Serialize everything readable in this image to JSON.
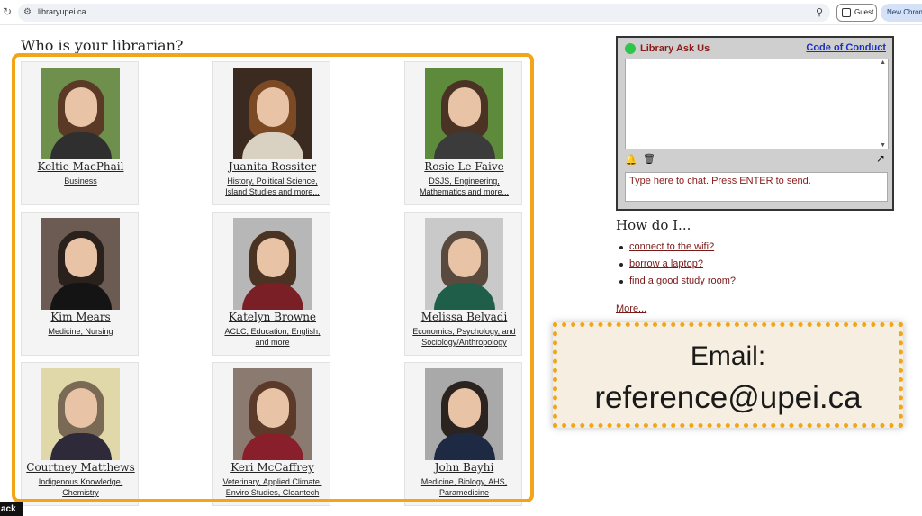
{
  "browser": {
    "url": "libraryupei.ca",
    "guest_label": "Guest",
    "new_chrome_label": "New Chrome"
  },
  "page": {
    "title": "Who is your librarian?"
  },
  "librarians": [
    {
      "name": "Keltie MacPhail",
      "subjects": [
        "Business"
      ],
      "photo_bg": "#6f8f4d",
      "hair": "#5a3a26",
      "top": "#2f2f2f"
    },
    {
      "name": "Juanita Rossiter",
      "subjects": [
        "History, Political Science,",
        "Island Studies and more..."
      ],
      "photo_bg": "#3a2a20",
      "hair": "#7b4a25",
      "top": "#d9d2c2"
    },
    {
      "name": "Rosie Le Faive",
      "subjects": [
        "DSJS, Engineering,",
        "Mathematics and more..."
      ],
      "photo_bg": "#5e8a3b",
      "hair": "#4a3324",
      "top": "#3b3b3b"
    },
    {
      "name": "Kim Mears",
      "subjects": [
        "Medicine, Nursing"
      ],
      "photo_bg": "#6b5b52",
      "hair": "#2a211c",
      "top": "#141414"
    },
    {
      "name": "Katelyn Browne",
      "subjects": [
        "ACLC, Education, English,",
        "and more"
      ],
      "photo_bg": "#b7b7b7",
      "hair": "#4a3322",
      "top": "#7a1f25"
    },
    {
      "name": "Melissa Belvadi",
      "subjects": [
        "Economics, Psychology, and",
        "Sociology/Anthropology"
      ],
      "photo_bg": "#c9c9c9",
      "hair": "#5a4a3e",
      "top": "#1f5f4a"
    },
    {
      "name": "Courtney Matthews",
      "subjects": [
        "Indigenous Knowledge,",
        "Chemistry"
      ],
      "photo_bg": "#e0d8a8",
      "hair": "#7a6a55",
      "top": "#2e2a3a"
    },
    {
      "name": "Keri McCaffrey",
      "subjects": [
        "Veterinary, Applied Climate,",
        "Enviro Studies, Cleantech"
      ],
      "photo_bg": "#8a7a70",
      "hair": "#5b3a2a",
      "top": "#8a1f2c"
    },
    {
      "name": "John Bayhi",
      "subjects": [
        "Medicine, Biology, AHS,",
        "Paramedicine"
      ],
      "photo_bg": "#a9a9a9",
      "hair": "#2a2320",
      "top": "#1e2a44"
    }
  ],
  "chat": {
    "title": "Library Ask Us",
    "code_of_conduct": "Code of Conduct",
    "input_placeholder": "Type here to chat. Press ENTER to send."
  },
  "howdoi": {
    "title": "How do I...",
    "links": [
      "connect to the wifi?",
      "borrow a laptop?",
      "find a good study room?"
    ],
    "more": "More..."
  },
  "callout": {
    "label": "Email:",
    "address": "reference@upei.ca"
  },
  "back_label": "ack"
}
